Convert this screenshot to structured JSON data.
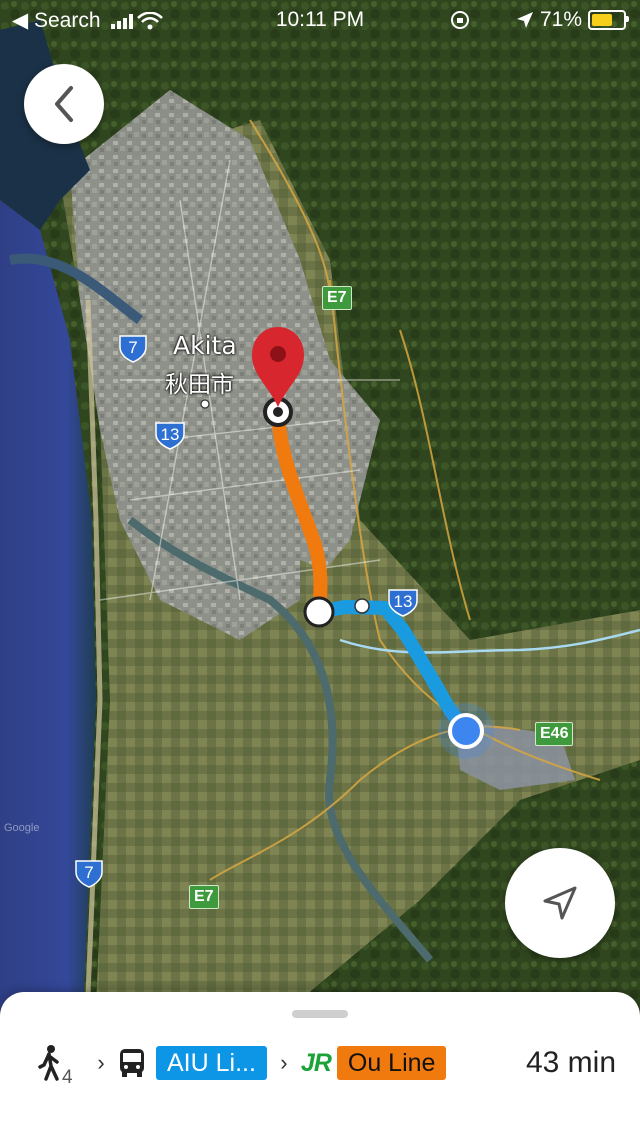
{
  "status_bar": {
    "back_label": "◀ Search",
    "time": "10:11 PM",
    "battery": "71%"
  },
  "map": {
    "city_name_en": "Akita",
    "city_name_ja": "秋田市",
    "watermark": "Google",
    "road_shields": [
      {
        "label": "E7",
        "kind": "expressway"
      },
      {
        "label": "7",
        "kind": "national"
      },
      {
        "label": "13",
        "kind": "national"
      },
      {
        "label": "13",
        "kind": "national"
      },
      {
        "label": "E46",
        "kind": "expressway"
      },
      {
        "label": "7",
        "kind": "national"
      },
      {
        "label": "E7",
        "kind": "expressway"
      }
    ],
    "colors": {
      "bus_segment": "#1a9be0",
      "train_segment": "#f07a0e",
      "destination_pin": "#d8262f",
      "current_location": "#3d86f0"
    }
  },
  "controls": {
    "back_icon": "chevron-left-icon",
    "location_icon": "navigation-arrow-icon"
  },
  "route_summary": {
    "walk_minutes": "4",
    "bus_line": "AIU Li...",
    "rail_brand": "JR",
    "train_line": "Ou Line",
    "duration": "43 min",
    "colors": {
      "bus": "#0d96e6",
      "train": "#f07a0e",
      "jr": "#1ba33a"
    }
  }
}
